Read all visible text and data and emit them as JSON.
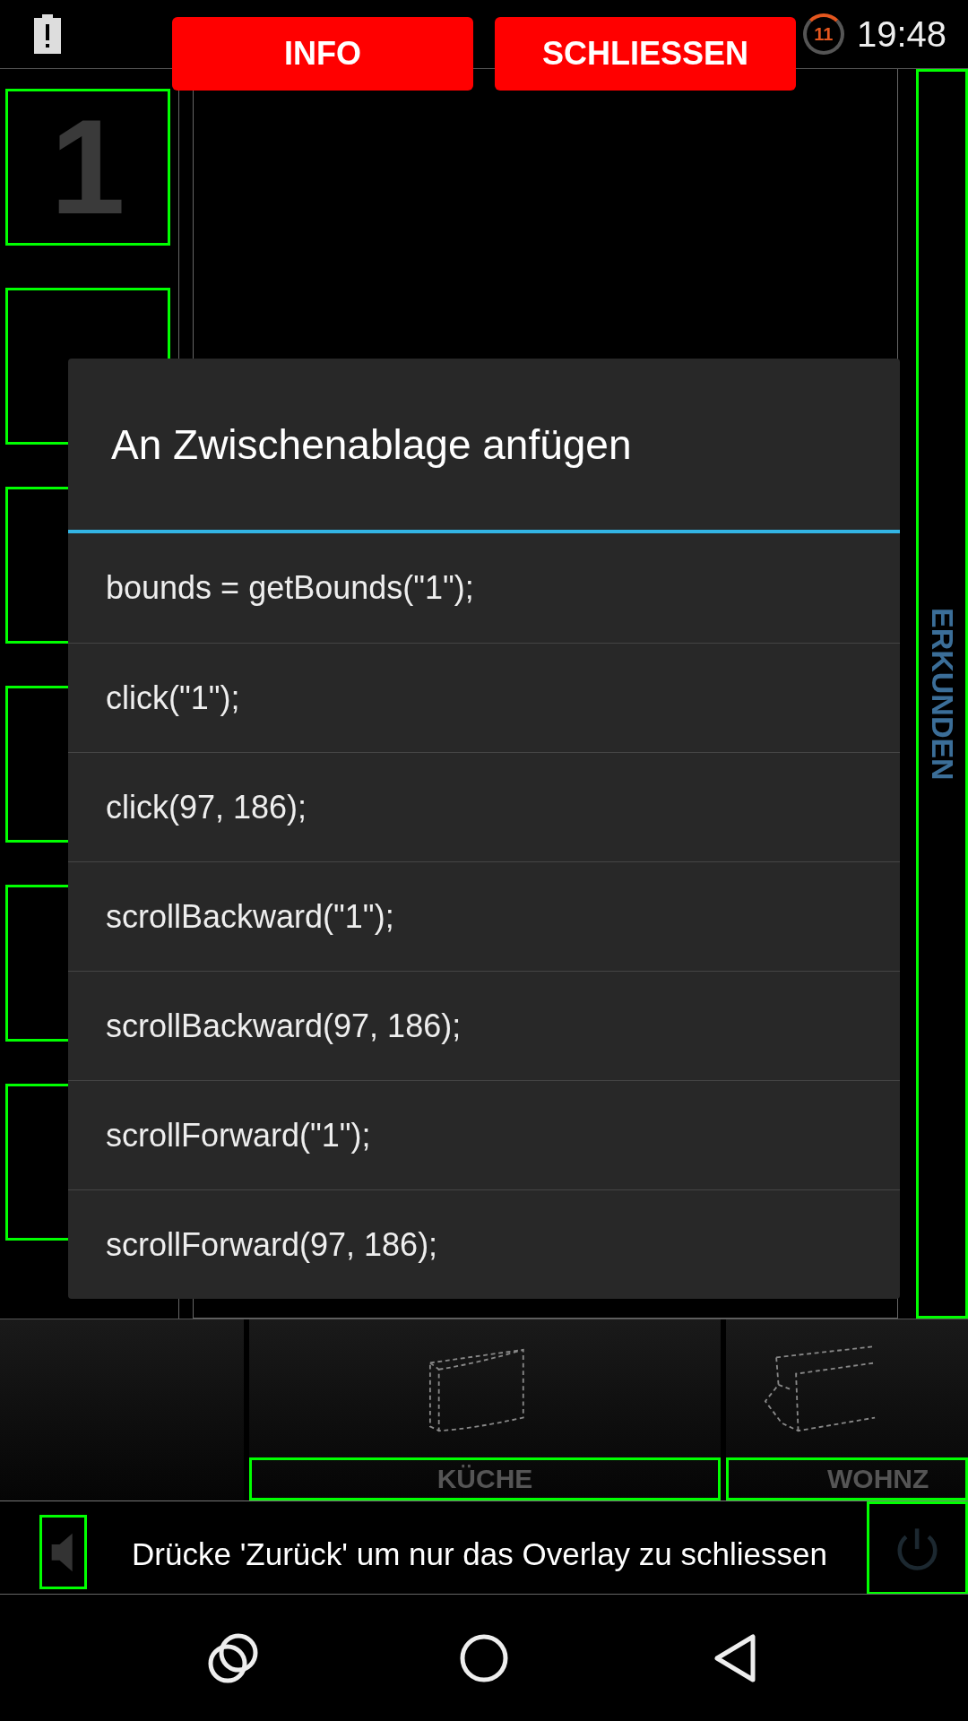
{
  "status_bar": {
    "time": "19:48",
    "badge": "11"
  },
  "top_buttons": [
    {
      "label": "INFO"
    },
    {
      "label": "SCHLIESSEN"
    }
  ],
  "presets": [
    {
      "label": "1",
      "highlighted": true
    },
    {
      "highlighted": true
    },
    {
      "highlighted": true
    },
    {
      "highlighted": true
    },
    {
      "highlighted": true
    },
    {
      "highlighted": true
    }
  ],
  "explore": {
    "label": "ERKUNDEN",
    "highlighted": true
  },
  "rooms": [
    {
      "label": "KÜCHE",
      "highlighted": true
    },
    {
      "label": "WOHNZ",
      "highlighted": true
    }
  ],
  "controls": {
    "volume_highlighted": true,
    "power_highlighted": true
  },
  "dialog": {
    "title": "An Zwischenablage anfügen",
    "items": [
      "bounds = getBounds(\"1\");",
      "click(\"1\");",
      "click(97, 186);",
      "scrollBackward(\"1\");",
      "scrollBackward(97, 186);",
      "scrollForward(\"1\");",
      "scrollForward(97, 186);"
    ]
  },
  "overlay_hint": "Drücke 'Zurück' um nur das Overlay zu schliessen"
}
